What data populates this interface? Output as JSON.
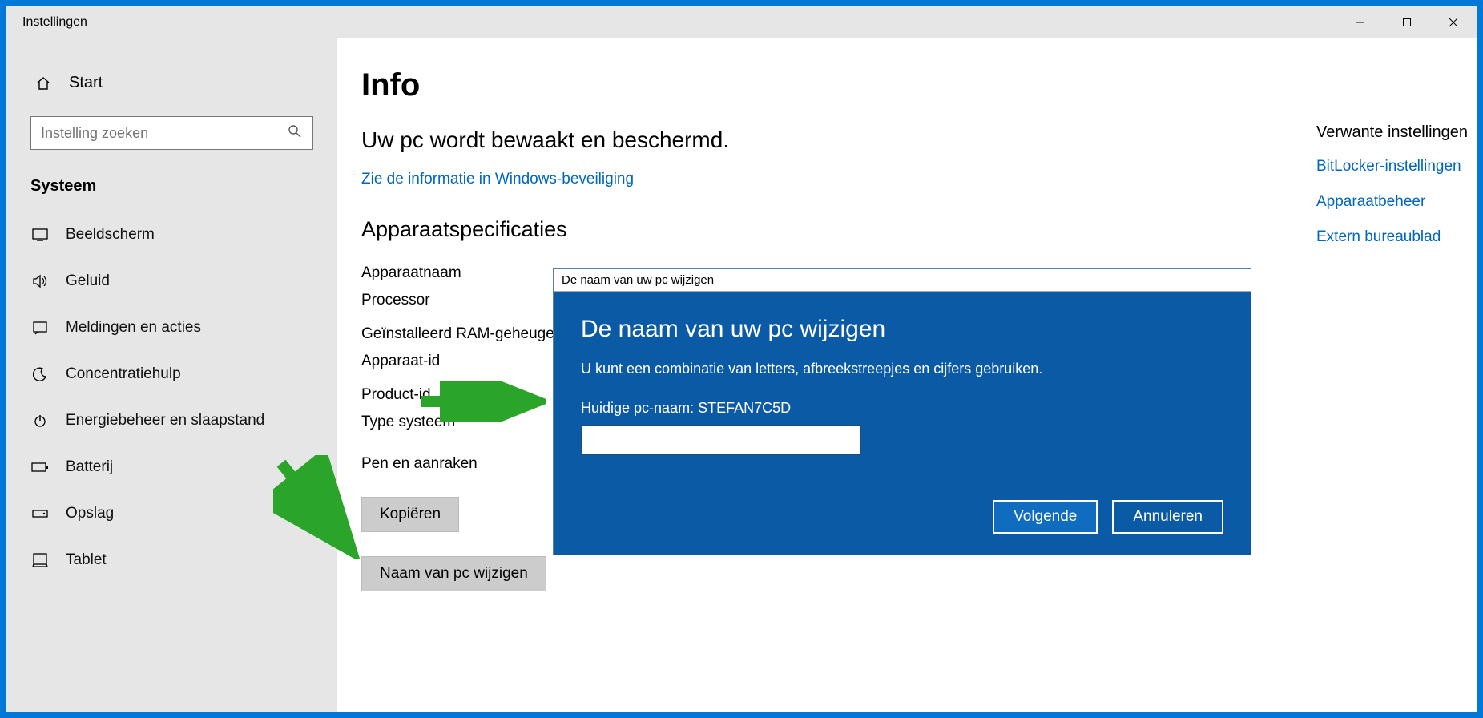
{
  "window": {
    "title": "Instellingen"
  },
  "sidebar": {
    "home": "Start",
    "search_placeholder": "Instelling zoeken",
    "section": "Systeem",
    "items": [
      "Beeldscherm",
      "Geluid",
      "Meldingen en acties",
      "Concentratiehulp",
      "Energiebeheer en slaapstand",
      "Batterij",
      "Opslag",
      "Tablet"
    ]
  },
  "main": {
    "heading": "Info",
    "guard_h": "Uw pc wordt bewaakt en beschermd.",
    "guard_link": "Zie de informatie in Windows-beveiliging",
    "spec_h": "Apparaatspecificaties",
    "rows": {
      "device_name": "Apparaatnaam",
      "processor": "Processor",
      "ram": "Geïnstalleerd RAM-geheugen",
      "device_id": "Apparaat-id",
      "product_id": "Product-id",
      "system_type": "Type systeem",
      "pen": "Pen en aanraken"
    },
    "copy_btn": "Kopiëren",
    "rename_btn": "Naam van pc wijzigen"
  },
  "rail": {
    "heading": "Verwante instellingen",
    "links": [
      "BitLocker-instellingen",
      "Apparaatbeheer",
      "Extern bureaublad"
    ]
  },
  "dialog": {
    "titlebar": "De naam van uw pc wijzigen",
    "heading": "De naam van uw pc wijzigen",
    "desc": "U kunt een combinatie van letters, afbreekstreepjes en cijfers gebruiken.",
    "current": "Huidige pc-naam: STEFAN7C5D",
    "input_value": "",
    "next": "Volgende",
    "cancel": "Annuleren"
  }
}
